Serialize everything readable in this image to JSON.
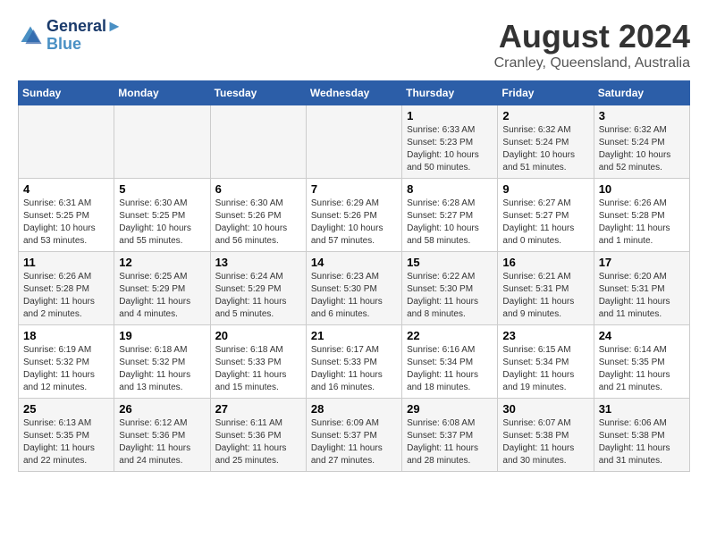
{
  "logo": {
    "line1": "General",
    "line2": "Blue"
  },
  "title": "August 2024",
  "subtitle": "Cranley, Queensland, Australia",
  "days_of_week": [
    "Sunday",
    "Monday",
    "Tuesday",
    "Wednesday",
    "Thursday",
    "Friday",
    "Saturday"
  ],
  "weeks": [
    [
      {
        "day": "",
        "content": ""
      },
      {
        "day": "",
        "content": ""
      },
      {
        "day": "",
        "content": ""
      },
      {
        "day": "",
        "content": ""
      },
      {
        "day": "1",
        "content": "Sunrise: 6:33 AM\nSunset: 5:23 PM\nDaylight: 10 hours\nand 50 minutes."
      },
      {
        "day": "2",
        "content": "Sunrise: 6:32 AM\nSunset: 5:24 PM\nDaylight: 10 hours\nand 51 minutes."
      },
      {
        "day": "3",
        "content": "Sunrise: 6:32 AM\nSunset: 5:24 PM\nDaylight: 10 hours\nand 52 minutes."
      }
    ],
    [
      {
        "day": "4",
        "content": "Sunrise: 6:31 AM\nSunset: 5:25 PM\nDaylight: 10 hours\nand 53 minutes."
      },
      {
        "day": "5",
        "content": "Sunrise: 6:30 AM\nSunset: 5:25 PM\nDaylight: 10 hours\nand 55 minutes."
      },
      {
        "day": "6",
        "content": "Sunrise: 6:30 AM\nSunset: 5:26 PM\nDaylight: 10 hours\nand 56 minutes."
      },
      {
        "day": "7",
        "content": "Sunrise: 6:29 AM\nSunset: 5:26 PM\nDaylight: 10 hours\nand 57 minutes."
      },
      {
        "day": "8",
        "content": "Sunrise: 6:28 AM\nSunset: 5:27 PM\nDaylight: 10 hours\nand 58 minutes."
      },
      {
        "day": "9",
        "content": "Sunrise: 6:27 AM\nSunset: 5:27 PM\nDaylight: 11 hours\nand 0 minutes."
      },
      {
        "day": "10",
        "content": "Sunrise: 6:26 AM\nSunset: 5:28 PM\nDaylight: 11 hours\nand 1 minute."
      }
    ],
    [
      {
        "day": "11",
        "content": "Sunrise: 6:26 AM\nSunset: 5:28 PM\nDaylight: 11 hours\nand 2 minutes."
      },
      {
        "day": "12",
        "content": "Sunrise: 6:25 AM\nSunset: 5:29 PM\nDaylight: 11 hours\nand 4 minutes."
      },
      {
        "day": "13",
        "content": "Sunrise: 6:24 AM\nSunset: 5:29 PM\nDaylight: 11 hours\nand 5 minutes."
      },
      {
        "day": "14",
        "content": "Sunrise: 6:23 AM\nSunset: 5:30 PM\nDaylight: 11 hours\nand 6 minutes."
      },
      {
        "day": "15",
        "content": "Sunrise: 6:22 AM\nSunset: 5:30 PM\nDaylight: 11 hours\nand 8 minutes."
      },
      {
        "day": "16",
        "content": "Sunrise: 6:21 AM\nSunset: 5:31 PM\nDaylight: 11 hours\nand 9 minutes."
      },
      {
        "day": "17",
        "content": "Sunrise: 6:20 AM\nSunset: 5:31 PM\nDaylight: 11 hours\nand 11 minutes."
      }
    ],
    [
      {
        "day": "18",
        "content": "Sunrise: 6:19 AM\nSunset: 5:32 PM\nDaylight: 11 hours\nand 12 minutes."
      },
      {
        "day": "19",
        "content": "Sunrise: 6:18 AM\nSunset: 5:32 PM\nDaylight: 11 hours\nand 13 minutes."
      },
      {
        "day": "20",
        "content": "Sunrise: 6:18 AM\nSunset: 5:33 PM\nDaylight: 11 hours\nand 15 minutes."
      },
      {
        "day": "21",
        "content": "Sunrise: 6:17 AM\nSunset: 5:33 PM\nDaylight: 11 hours\nand 16 minutes."
      },
      {
        "day": "22",
        "content": "Sunrise: 6:16 AM\nSunset: 5:34 PM\nDaylight: 11 hours\nand 18 minutes."
      },
      {
        "day": "23",
        "content": "Sunrise: 6:15 AM\nSunset: 5:34 PM\nDaylight: 11 hours\nand 19 minutes."
      },
      {
        "day": "24",
        "content": "Sunrise: 6:14 AM\nSunset: 5:35 PM\nDaylight: 11 hours\nand 21 minutes."
      }
    ],
    [
      {
        "day": "25",
        "content": "Sunrise: 6:13 AM\nSunset: 5:35 PM\nDaylight: 11 hours\nand 22 minutes."
      },
      {
        "day": "26",
        "content": "Sunrise: 6:12 AM\nSunset: 5:36 PM\nDaylight: 11 hours\nand 24 minutes."
      },
      {
        "day": "27",
        "content": "Sunrise: 6:11 AM\nSunset: 5:36 PM\nDaylight: 11 hours\nand 25 minutes."
      },
      {
        "day": "28",
        "content": "Sunrise: 6:09 AM\nSunset: 5:37 PM\nDaylight: 11 hours\nand 27 minutes."
      },
      {
        "day": "29",
        "content": "Sunrise: 6:08 AM\nSunset: 5:37 PM\nDaylight: 11 hours\nand 28 minutes."
      },
      {
        "day": "30",
        "content": "Sunrise: 6:07 AM\nSunset: 5:38 PM\nDaylight: 11 hours\nand 30 minutes."
      },
      {
        "day": "31",
        "content": "Sunrise: 6:06 AM\nSunset: 5:38 PM\nDaylight: 11 hours\nand 31 minutes."
      }
    ]
  ]
}
